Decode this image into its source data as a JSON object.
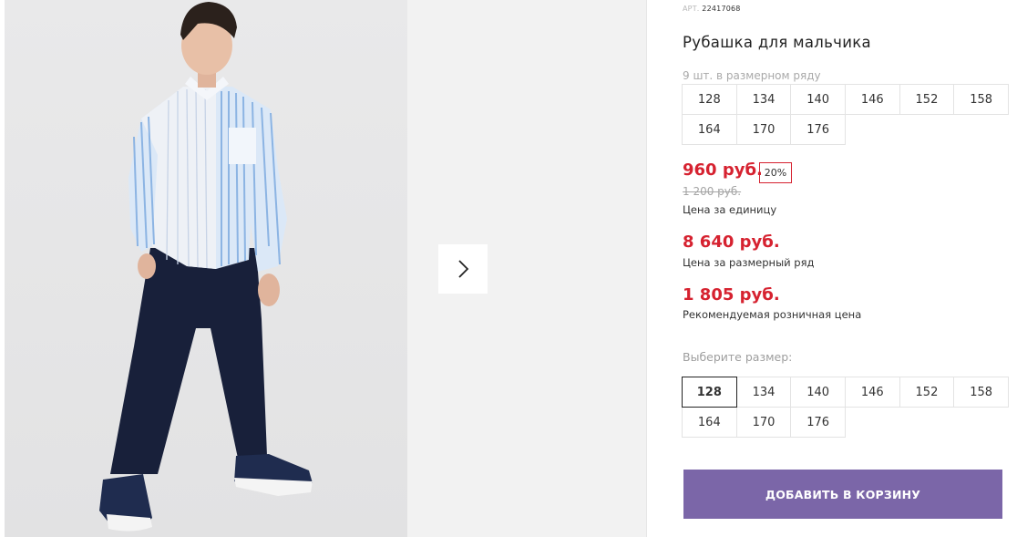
{
  "product": {
    "sku_label": "АРТ.",
    "sku": "22417068",
    "title": "Рубашка для мальчика",
    "pack_note": "9 шт. в размерном ряду",
    "pack_sizes": [
      "128",
      "134",
      "140",
      "146",
      "152",
      "158",
      "164",
      "170",
      "176"
    ]
  },
  "pricing": {
    "price": "960 руб.",
    "discount": "20%",
    "old_price": "1 200 руб.",
    "unit_label": "Цена за единицу",
    "set_price": "8 640 руб.",
    "set_label": "Цена за размерный ряд",
    "retail_price": "1 805 руб.",
    "retail_label": "Рекомендуемая розничная цена"
  },
  "size_select": {
    "label": "Выберите размер:",
    "selected": "128",
    "sizes": [
      "128",
      "134",
      "140",
      "146",
      "152",
      "158",
      "164",
      "170",
      "176"
    ]
  },
  "actions": {
    "add_to_cart": "ДОБАВИТЬ В КОРЗИНУ"
  },
  "gallery": {
    "next_icon": "chevron-right-icon"
  },
  "colors": {
    "accent": "#7b66a8",
    "price": "#d62230"
  }
}
